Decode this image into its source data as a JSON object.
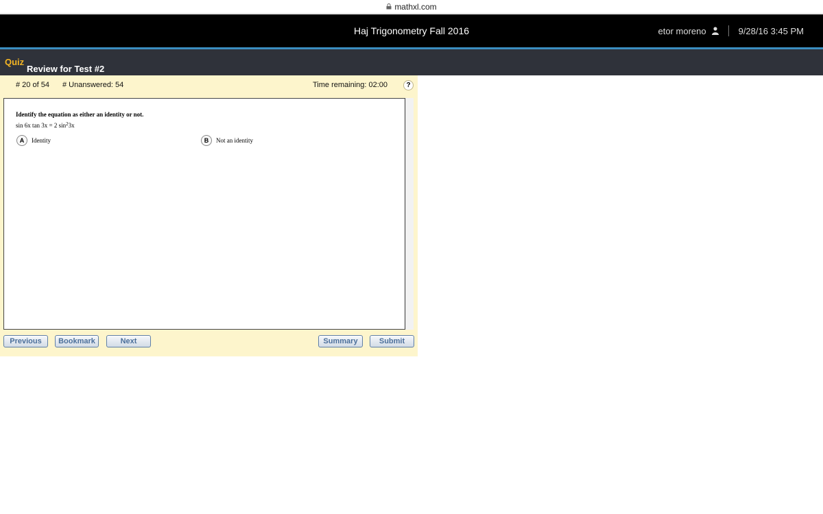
{
  "browser": {
    "url": "mathxl.com"
  },
  "header": {
    "course_title": "Haj Trigonometry Fall 2016",
    "user_name": "etor moreno",
    "datetime": "9/28/16 3:45 PM"
  },
  "quiz": {
    "label": "Quiz",
    "title": "Review for Test #2",
    "question_number": "# 20 of 54",
    "unanswered": "# Unanswered:  54",
    "time_remaining": "Time remaining: 02:00",
    "help": "?"
  },
  "question": {
    "instruction": "Identify the equation as either an identity or not.",
    "equation_left": "sin 6x tan 3x = 2 sin",
    "equation_exp": "2",
    "equation_right": "3x",
    "choices": [
      {
        "letter": "A",
        "text": "Identity"
      },
      {
        "letter": "B",
        "text": "Not an identity"
      }
    ]
  },
  "buttons": {
    "previous": "Previous",
    "bookmark": "Bookmark",
    "next": "Next",
    "summary": "Summary",
    "submit": "Submit"
  },
  "colors": {
    "quiz_label": "#f5b623",
    "panel_bg": "#fdf5cc",
    "header_bg": "#000000",
    "stripe": "#3b8ec0",
    "button_text": "#4b6f9a"
  },
  "icons": {
    "lock": "lock-icon",
    "user": "user-icon",
    "help": "help-icon"
  }
}
